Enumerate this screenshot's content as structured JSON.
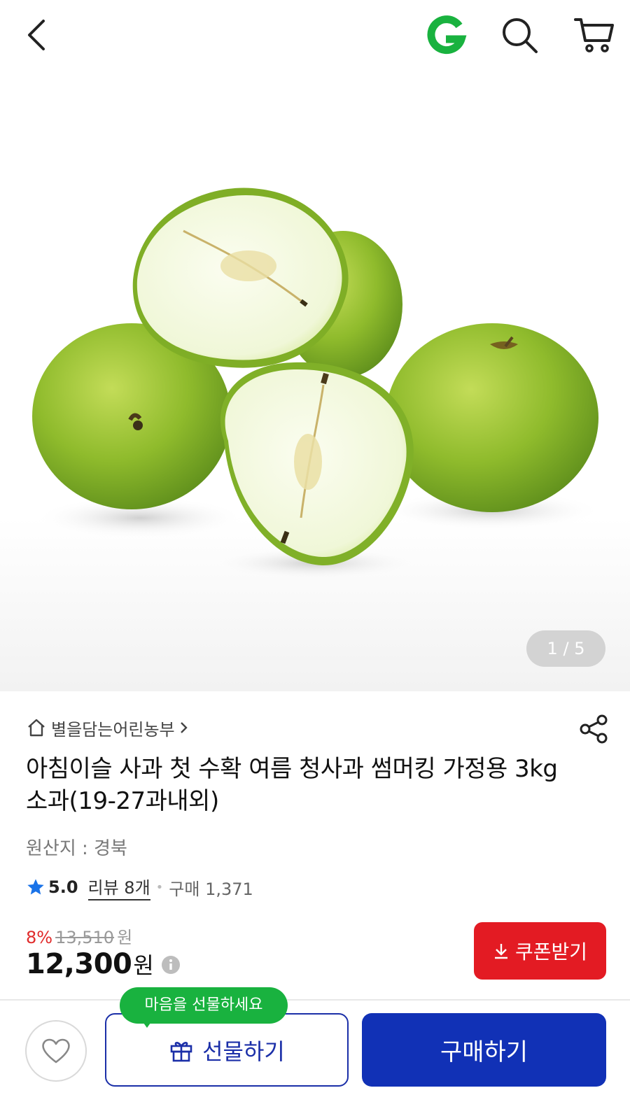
{
  "header": {
    "back_icon": "chevron-left-icon",
    "logo_icon": "g-logo-icon",
    "search_icon": "search-icon",
    "cart_icon": "cart-icon",
    "brand_color": "#19b23f"
  },
  "gallery": {
    "current": "1",
    "separator": "/",
    "total": "5"
  },
  "product": {
    "seller": "별을담는어린농부",
    "title": "아침이슬 사과 첫 수확 여름 청사과 썸머킹 가정용 3kg 소과(19-27과내외)",
    "origin": "원산지 : 경북",
    "rating": "5.0",
    "review": "리뷰 8개",
    "purchase": "구매 1,371"
  },
  "price": {
    "discount": "8%",
    "original": "13,510",
    "original_unit": "원",
    "current": "12,300",
    "current_unit": "원"
  },
  "coupon": {
    "label": "쿠폰받기",
    "color": "#e31b23"
  },
  "actions": {
    "gift_tooltip": "마음을 선물하세요",
    "gift_label": "선물하기",
    "buy_label": "구매하기",
    "accent": "#1131b6"
  }
}
